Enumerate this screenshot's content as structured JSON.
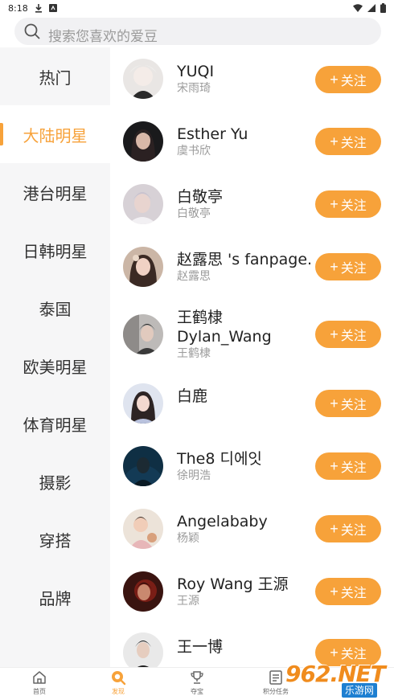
{
  "status_bar": {
    "time": "8:18"
  },
  "search": {
    "placeholder": "搜索您喜欢的爱豆"
  },
  "sidebar": {
    "items": [
      {
        "label": "热门",
        "active": false
      },
      {
        "label": "大陆明星",
        "active": true
      },
      {
        "label": "港台明星",
        "active": false
      },
      {
        "label": "日韩明星",
        "active": false
      },
      {
        "label": "泰国",
        "active": false
      },
      {
        "label": "欧美明星",
        "active": false
      },
      {
        "label": "体育明星",
        "active": false
      },
      {
        "label": "摄影",
        "active": false
      },
      {
        "label": "穿搭",
        "active": false
      },
      {
        "label": "品牌",
        "active": false
      }
    ]
  },
  "follow_label": "关注",
  "follow_plus": "+",
  "idols": [
    {
      "name": "YUQI",
      "name2": "",
      "sub": "宋雨琦"
    },
    {
      "name": "Esther Yu",
      "name2": "",
      "sub": "虞书欣"
    },
    {
      "name": "白敬亭",
      "name2": "",
      "sub": "白敬亭"
    },
    {
      "name": "赵露思 's fanpage.",
      "name2": "",
      "sub": "赵露思"
    },
    {
      "name": "王鹤棣",
      "name2": "Dylan_Wang",
      "sub": "王鹤棣"
    },
    {
      "name": "白鹿",
      "name2": "",
      "sub": ""
    },
    {
      "name": "The8 디에잇",
      "name2": "",
      "sub": "徐明浩"
    },
    {
      "name": "Angelababy",
      "name2": "",
      "sub": "杨颖"
    },
    {
      "name": "Roy Wang 王源",
      "name2": "",
      "sub": "王源"
    },
    {
      "name": "王一博",
      "name2": "",
      "sub": ""
    }
  ],
  "bottom_nav": [
    {
      "label": "首页",
      "icon": "home-icon",
      "active": false
    },
    {
      "label": "发现",
      "icon": "discover-icon",
      "active": true
    },
    {
      "label": "夺宝",
      "icon": "trophy-icon",
      "active": false
    },
    {
      "label": "积分任务",
      "icon": "tasks-icon",
      "active": false
    }
  ],
  "watermark": {
    "text": "962.NET",
    "sub": "乐游网"
  },
  "colors": {
    "accent": "#f7a23a",
    "sidebar_bg": "#f6f6f7"
  }
}
